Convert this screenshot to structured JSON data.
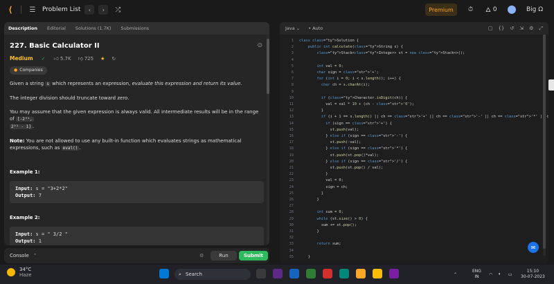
{
  "topbar": {
    "problem_list": "Problem List",
    "premium": "Premium",
    "streak": "0",
    "user": "Big Ω"
  },
  "tabs": [
    "Description",
    "Editorial",
    "Solutions (1.7K)",
    "Submissions"
  ],
  "problem": {
    "title": "227. Basic Calculator II",
    "difficulty": "Medium",
    "likes": "5.7K",
    "dislikes": "725",
    "companies": "Companies",
    "p1_a": "Given a string ",
    "p1_code": "s",
    "p1_b": " which represents an expression, ",
    "p1_em": "evaluate this expression and return its value.",
    "p2": "The integer division should truncate toward zero.",
    "p3_a": "You may assume that the given expression is always valid. All intermediate results will be in the range of ",
    "range_lo": "[-2³¹,",
    "range_hi": "2³¹ - 1]",
    "p3_end": ".",
    "note_label": "Note:",
    "note_text": " You are not allowed to use any built-in function which evaluates strings as mathematical expressions, such as ",
    "note_code": "eval()",
    "note_end": ".",
    "ex1_title": "Example 1:",
    "ex1_input_label": "Input:",
    "ex1_input": " s = \"3+2*2\"",
    "ex1_output_label": "Output:",
    "ex1_output": " 7",
    "ex2_title": "Example 2:",
    "ex2_input_label": "Input:",
    "ex2_input": " s = \" 3/2 \"",
    "ex2_output_label": "Output:",
    "ex2_output": " 1"
  },
  "console": {
    "label": "Console",
    "run": "Run",
    "submit": "Submit"
  },
  "editor": {
    "language": "Java",
    "mode": "Auto",
    "lines": [
      {
        "n": "1",
        "t": "class Solution {"
      },
      {
        "n": "2",
        "t": "    public int calculate(String s) {"
      },
      {
        "n": "3",
        "t": "        Stack<Integer> st = new Stack<>();"
      },
      {
        "n": "4",
        "t": ""
      },
      {
        "n": "5",
        "t": "        int val = 0;"
      },
      {
        "n": "6",
        "t": "        char sign = '+';"
      },
      {
        "n": "7",
        "t": "        for (int i = 0; i < s.length(); i++) {"
      },
      {
        "n": "8",
        "t": "          char ch = s.charAt(i);"
      },
      {
        "n": "9",
        "t": ""
      },
      {
        "n": "10",
        "t": "          if (Character.isDigit(ch)) {"
      },
      {
        "n": "11",
        "t": "            val = val * 10 + (ch - '0');"
      },
      {
        "n": "12",
        "t": "          }"
      },
      {
        "n": "13",
        "t": "          if (i + 1 == s.length() || ch == '+' || ch == '-' || ch == '*' || ch == '/') {"
      },
      {
        "n": "14",
        "t": "            if (sign == '+') {"
      },
      {
        "n": "15",
        "t": "              st.push(val);"
      },
      {
        "n": "16",
        "t": "            } else if (sign == '-') {"
      },
      {
        "n": "17",
        "t": "              st.push(-val);"
      },
      {
        "n": "18",
        "t": "            } else if (sign == '*') {"
      },
      {
        "n": "19",
        "t": "              st.push(st.pop()*val);"
      },
      {
        "n": "20",
        "t": "            } else if (sign == '/') {"
      },
      {
        "n": "21",
        "t": "              st.push(st.pop() / val);"
      },
      {
        "n": "22",
        "t": "            }"
      },
      {
        "n": "23",
        "t": "            val = 0;"
      },
      {
        "n": "24",
        "t": "            sign = ch;"
      },
      {
        "n": "25",
        "t": "          }"
      },
      {
        "n": "26",
        "t": "        }"
      },
      {
        "n": "27",
        "t": ""
      },
      {
        "n": "28",
        "t": "        int sum = 0;"
      },
      {
        "n": "29",
        "t": "        while (st.size() > 0) {"
      },
      {
        "n": "30",
        "t": "          sum += st.pop();"
      },
      {
        "n": "31",
        "t": "        }"
      },
      {
        "n": "32",
        "t": ""
      },
      {
        "n": "33",
        "t": "        return sum;"
      },
      {
        "n": "34",
        "t": ""
      },
      {
        "n": "35",
        "t": "    }"
      }
    ]
  },
  "taskbar": {
    "temp": "34°C",
    "weather": "Haze",
    "search": "Search",
    "lang1": "ENG",
    "lang2": "IN",
    "time": "15:10",
    "date": "30-07-2023"
  },
  "colors": {
    "accent": "#ffa116",
    "medium": "#ffc01e",
    "submit": "#2cbb5d"
  }
}
